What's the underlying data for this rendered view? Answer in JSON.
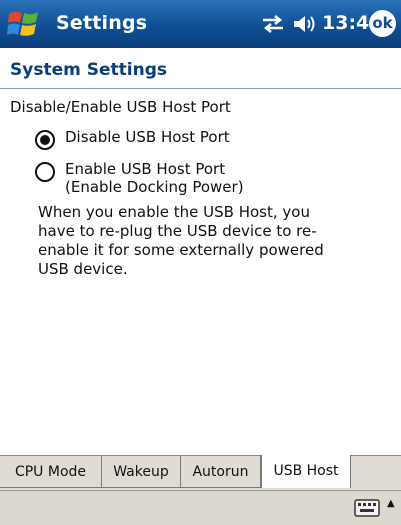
{
  "titlebar": {
    "app_title": "Settings",
    "time": "13:40",
    "ok_label": "ok"
  },
  "header": {
    "title": "System Settings"
  },
  "content": {
    "section_label": "Disable/Enable USB Host Port",
    "options": [
      {
        "label": "Disable USB Host Port",
        "selected": true
      },
      {
        "label_line1": "Enable USB Host Port",
        "label_line2": "(Enable Docking Power)",
        "selected": false
      }
    ],
    "description_lines": [
      "When you enable the USB Host, you",
      "have to re-plug the USB device to re-",
      "enable it for some externally powered",
      "USB device."
    ]
  },
  "tabs": [
    {
      "label": "CPU Mode",
      "active": false
    },
    {
      "label": "Wakeup",
      "active": false
    },
    {
      "label": "Autorun",
      "active": false
    },
    {
      "label": "USB Host",
      "active": true
    }
  ],
  "colors": {
    "titlebar": "#0f4f94",
    "header_text": "#0a3d7e"
  },
  "icons": [
    "windows-start-icon",
    "connectivity-icon",
    "volume-icon",
    "keyboard-icon",
    "up-arrow-icon"
  ]
}
